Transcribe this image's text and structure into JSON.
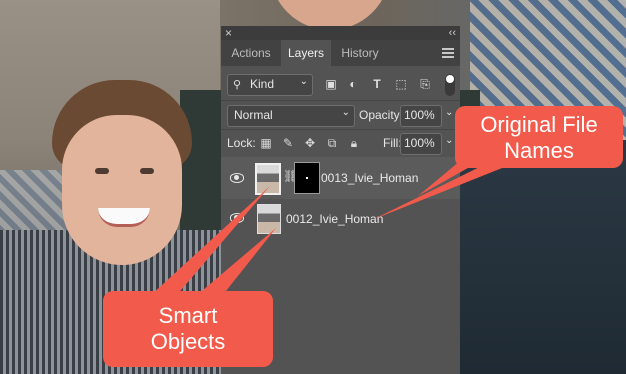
{
  "panel": {
    "close_glyph": "×",
    "collapse_glyph": "‹‹",
    "tabs": [
      {
        "label": "Actions"
      },
      {
        "label": "Layers"
      },
      {
        "label": "History"
      }
    ],
    "filter": {
      "kind_label": "Kind"
    },
    "blend_mode": "Normal",
    "opacity_label": "Opacity:",
    "opacity_value": "100%",
    "lock_label": "Lock:",
    "fill_label": "Fill:",
    "fill_value": "100%",
    "layers": [
      {
        "name": "0013_Ivie_Homan",
        "has_mask": true
      },
      {
        "name": "0012_Ivie_Homan",
        "has_mask": false
      }
    ]
  },
  "callouts": {
    "original_file_names": [
      "Original File",
      "Names"
    ],
    "smart_objects": [
      "Smart",
      "Objects"
    ]
  },
  "colors": {
    "callout": "#f25b4b",
    "panel_bg": "#535353"
  }
}
